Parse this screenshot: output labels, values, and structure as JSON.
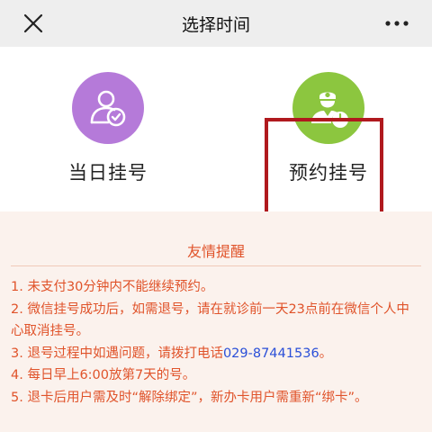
{
  "header": {
    "title": "选择时间",
    "close_icon": "close-icon",
    "more_icon": "more-icon"
  },
  "options": [
    {
      "label": "当日挂号",
      "icon": "user-check-icon",
      "color": "#b57ad9"
    },
    {
      "label": "预约挂号",
      "icon": "doctor-clock-icon",
      "color": "#8cc63f",
      "selected": true
    }
  ],
  "notice": {
    "title": "友情提醒",
    "items": [
      {
        "text": "1.  未支付30分钟内不能继续预约。"
      },
      {
        "text": "2.  微信挂号成功后，如需退号，请在就诊前一天23点前在微信个人中心取消挂号。"
      },
      {
        "text_before": "3.  退号过程中如遇问题，请拨打电话",
        "phone": "029-87441536",
        "text_after": "。"
      },
      {
        "text": "4.  每日早上6:00放第7天的号。"
      },
      {
        "text": "5.  退卡后用户需及时“解除绑定”，新办卡用户需重新“绑卡”。"
      }
    ]
  },
  "colors": {
    "header_bg": "#eeeeee",
    "notice_bg": "#fbf2ed",
    "notice_text": "#e0532a",
    "phone_link": "#2a4fd8",
    "selected_border": "#b0191e"
  }
}
